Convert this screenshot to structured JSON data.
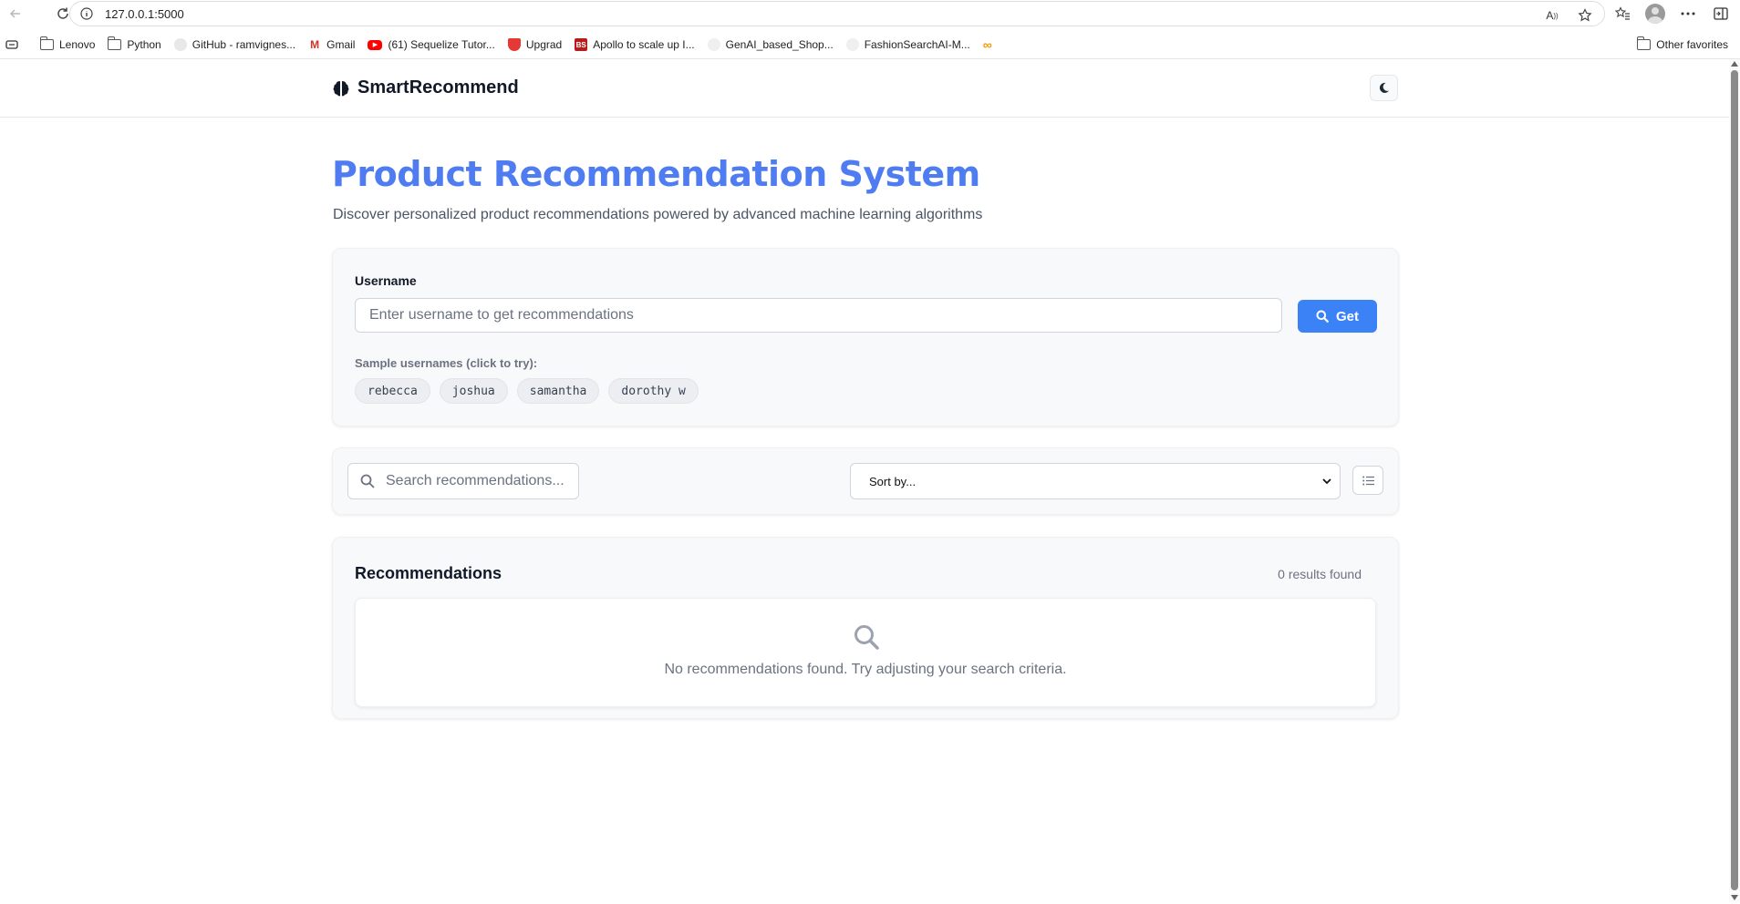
{
  "browser": {
    "url": "127.0.0.1:5000",
    "bookmarks": [
      {
        "label": "Lenovo",
        "icon": "folder-icon"
      },
      {
        "label": "Python",
        "icon": "folder-icon"
      },
      {
        "label": "GitHub - ramvignes...",
        "icon": "github-icon"
      },
      {
        "label": "Gmail",
        "icon": "gmail-icon"
      },
      {
        "label": "(61) Sequelize Tutor...",
        "icon": "youtube-icon"
      },
      {
        "label": "Upgrad",
        "icon": "upgrad-icon"
      },
      {
        "label": "Apollo to scale up I...",
        "icon": "bs-icon"
      },
      {
        "label": "GenAI_based_Shop...",
        "icon": "github-icon"
      },
      {
        "label": "FashionSearchAI-M...",
        "icon": "github-icon"
      }
    ],
    "other_favorites": "Other favorites"
  },
  "header": {
    "brand_name": "SmartRecommend"
  },
  "hero": {
    "title": "Product Recommendation System",
    "subtitle": "Discover personalized product recommendations powered by advanced machine learning algorithms"
  },
  "user_form": {
    "label": "Username",
    "placeholder": "Enter username to get recommendations",
    "value": "",
    "button_label": "Get",
    "samples_label": "Sample usernames (click to try):",
    "samples": [
      "rebecca",
      "joshua",
      "samantha",
      "dorothy w"
    ]
  },
  "filters": {
    "search_placeholder": "Search recommendations...",
    "sort_label": "Sort by..."
  },
  "recommendations": {
    "title": "Recommendations",
    "count_text": "0 results found",
    "empty_text": "No recommendations found. Try adjusting your search criteria."
  },
  "colors": {
    "accent": "#3b82f6",
    "title": "#4f7cf0"
  }
}
